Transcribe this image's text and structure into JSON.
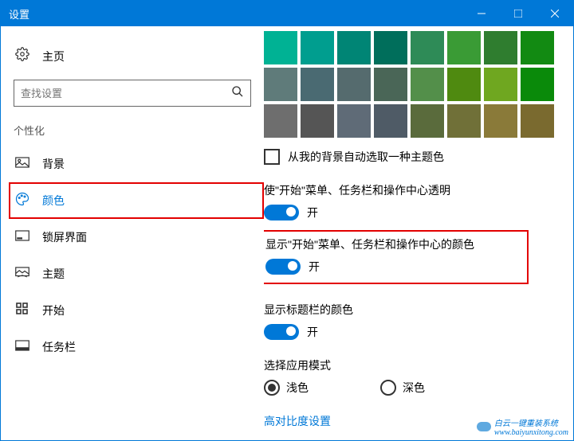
{
  "titlebar": {
    "title": "设置"
  },
  "sidebar": {
    "home": "主页",
    "search_placeholder": "查找设置",
    "group": "个性化",
    "items": [
      {
        "label": "背景"
      },
      {
        "label": "颜色"
      },
      {
        "label": "锁屏界面"
      },
      {
        "label": "主题"
      },
      {
        "label": "开始"
      },
      {
        "label": "任务栏"
      }
    ]
  },
  "main": {
    "swatches": [
      [
        "#00b294",
        "#009e8f",
        "#008575",
        "#006e5b",
        "#2e8b57",
        "#3a9b35",
        "#2f7d2f",
        "#128a12"
      ],
      [
        "#5f7b7a",
        "#4a6a72",
        "#556b6e",
        "#4a6657",
        "#538f4a",
        "#4f8a10",
        "#6fa720",
        "#0a8a0a"
      ],
      [
        "#6e6e6e",
        "#555555",
        "#5f6b77",
        "#4f5b66",
        "#5a6b3c",
        "#707038",
        "#8a7a39",
        "#7a6a2f"
      ]
    ],
    "auto_from_bg": {
      "label": "从我的背景自动选取一种主题色",
      "checked": false
    },
    "transparency": {
      "title": "使\"开始\"菜单、任务栏和操作中心透明",
      "on": true,
      "on_label": "开"
    },
    "show_color": {
      "title": "显示\"开始\"菜单、任务栏和操作中心的颜色",
      "on": true,
      "on_label": "开"
    },
    "title_bar_color": {
      "title": "显示标题栏的颜色",
      "on": true,
      "on_label": "开"
    },
    "app_mode": {
      "title": "选择应用模式",
      "light": "浅色",
      "dark": "深色",
      "selected": "light"
    },
    "high_contrast": "高对比度设置"
  },
  "watermark": {
    "brand": "白云一键重装系统",
    "url": "www.baiyunxitong.com"
  }
}
